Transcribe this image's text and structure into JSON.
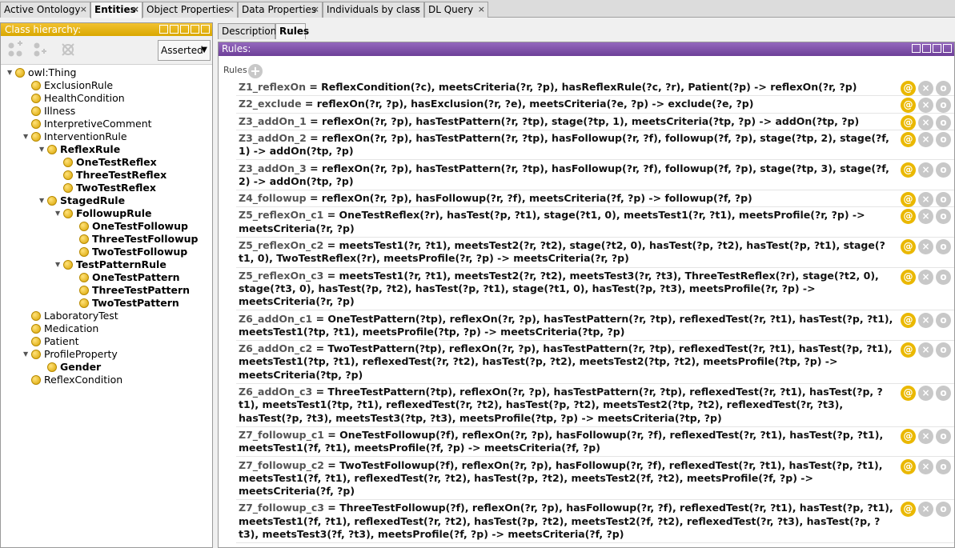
{
  "tabs": [
    {
      "label": "Active Ontology",
      "active": false
    },
    {
      "label": "Entities",
      "active": true
    },
    {
      "label": "Object Properties",
      "active": false
    },
    {
      "label": "Data Properties",
      "active": false
    },
    {
      "label": "Individuals by class",
      "active": false
    },
    {
      "label": "DL Query",
      "active": false
    }
  ],
  "tab_close_glyph": "×",
  "left": {
    "header": "Class hierarchy:",
    "mode": "Asserted",
    "tree": [
      {
        "label": "owl:Thing",
        "depth": 0,
        "bold": false,
        "expanded": true
      },
      {
        "label": "ExclusionRule",
        "depth": 1,
        "bold": false
      },
      {
        "label": "HealthCondition",
        "depth": 1,
        "bold": false
      },
      {
        "label": "Illness",
        "depth": 1,
        "bold": false
      },
      {
        "label": "InterpretiveComment",
        "depth": 1,
        "bold": false
      },
      {
        "label": "InterventionRule",
        "depth": 1,
        "bold": false,
        "expanded": true
      },
      {
        "label": "ReflexRule",
        "depth": 2,
        "bold": true,
        "expanded": true
      },
      {
        "label": "OneTestReflex",
        "depth": 3,
        "bold": true
      },
      {
        "label": "ThreeTestReflex",
        "depth": 3,
        "bold": true
      },
      {
        "label": "TwoTestReflex",
        "depth": 3,
        "bold": true
      },
      {
        "label": "StagedRule",
        "depth": 2,
        "bold": true,
        "expanded": true
      },
      {
        "label": "FollowupRule",
        "depth": 3,
        "bold": true,
        "expanded": true
      },
      {
        "label": "OneTestFollowup",
        "depth": 4,
        "bold": true
      },
      {
        "label": "ThreeTestFollowup",
        "depth": 4,
        "bold": true
      },
      {
        "label": "TwoTestFollowup",
        "depth": 4,
        "bold": true
      },
      {
        "label": "TestPatternRule",
        "depth": 3,
        "bold": true,
        "expanded": true
      },
      {
        "label": "OneTestPattern",
        "depth": 4,
        "bold": true
      },
      {
        "label": "ThreeTestPattern",
        "depth": 4,
        "bold": true
      },
      {
        "label": "TwoTestPattern",
        "depth": 4,
        "bold": true
      },
      {
        "label": "LaboratoryTest",
        "depth": 1,
        "bold": false
      },
      {
        "label": "Medication",
        "depth": 1,
        "bold": false
      },
      {
        "label": "Patient",
        "depth": 1,
        "bold": false
      },
      {
        "label": "ProfileProperty",
        "depth": 1,
        "bold": false,
        "expanded": true
      },
      {
        "label": "Gender",
        "depth": 2,
        "bold": true
      },
      {
        "label": "ReflexCondition",
        "depth": 1,
        "bold": false
      }
    ]
  },
  "right": {
    "tabs": [
      {
        "label": "Description",
        "active": false
      },
      {
        "label": "Rules",
        "active": true
      }
    ],
    "header": "Rules:",
    "rules_label": "Rules",
    "add_glyph": "+",
    "control_glyphs": {
      "annotate": "@",
      "delete": "×",
      "edit": "o"
    },
    "rules": [
      {
        "name": "Z1_reflexOn",
        "body": " = ReflexCondition(?c), meetsCriteria(?r, ?p), hasReflexRule(?c, ?r), Patient(?p) -> reflexOn(?r, ?p)",
        "lines": 1
      },
      {
        "name": "Z2_exclude",
        "body": " = reflexOn(?r, ?p), hasExclusion(?r, ?e), meetsCriteria(?e, ?p) -> exclude(?e, ?p)",
        "lines": 1
      },
      {
        "name": "Z3_addOn_1",
        "body": " = reflexOn(?r, ?p), hasTestPattern(?r, ?tp), stage(?tp, 1), meetsCriteria(?tp, ?p) -> addOn(?tp, ?p)",
        "lines": 1
      },
      {
        "name": "Z3_addOn_2",
        "body": " = reflexOn(?r, ?p), hasTestPattern(?r, ?tp), hasFollowup(?r, ?f), followup(?f, ?p), stage(?tp, 2), stage(?f, 1) -> addOn(?tp, ?p)",
        "lines": 2
      },
      {
        "name": "Z3_addOn_3",
        "body": " = reflexOn(?r, ?p), hasTestPattern(?r, ?tp), hasFollowup(?r, ?f), followup(?f, ?p), stage(?tp, 3), stage(?f, 2) -> addOn(?tp, ?p)",
        "lines": 2
      },
      {
        "name": "Z4_followup",
        "body": " = reflexOn(?r, ?p), hasFollowup(?r, ?f), meetsCriteria(?f, ?p) -> followup(?f, ?p)",
        "lines": 1
      },
      {
        "name": "Z5_reflexOn_c1",
        "body": " = OneTestReflex(?r), hasTest(?p, ?t1), stage(?t1, 0), meetsTest1(?r, ?t1), meetsProfile(?r, ?p) -> meetsCriteria(?r, ?p)",
        "lines": 2
      },
      {
        "name": "Z5_reflexOn_c2",
        "body": " = meetsTest1(?r, ?t1), meetsTest2(?r, ?t2), stage(?t2, 0), hasTest(?p, ?t2), hasTest(?p, ?t1), stage(?t1, 0), TwoTestReflex(?r), meetsProfile(?r, ?p) -> meetsCriteria(?r, ?p)",
        "lines": 2
      },
      {
        "name": "Z5_reflexOn_c3",
        "body": " = meetsTest1(?r, ?t1), meetsTest2(?r, ?t2), meetsTest3(?r, ?t3), ThreeTestReflex(?r), stage(?t2, 0), stage(?t3, 0), hasTest(?p, ?t2), hasTest(?p, ?t1), stage(?t1, 0), hasTest(?p, ?t3), meetsProfile(?r, ?p) -> meetsCriteria(?r, ?p)",
        "lines": 3
      },
      {
        "name": "Z6_addOn_c1",
        "body": " = OneTestPattern(?tp), reflexOn(?r, ?p), hasTestPattern(?r, ?tp), reflexedTest(?r, ?t1), hasTest(?p, ?t1), meetsTest1(?tp, ?t1), meetsProfile(?tp, ?p) -> meetsCriteria(?tp, ?p)",
        "lines": 2
      },
      {
        "name": "Z6_addOn_c2",
        "body": " = TwoTestPattern(?tp), reflexOn(?r, ?p), hasTestPattern(?r, ?tp), reflexedTest(?r, ?t1), hasTest(?p, ?t1), meetsTest1(?tp, ?t1), reflexedTest(?r, ?t2), hasTest(?p, ?t2), meetsTest2(?tp, ?t2), meetsProfile(?tp, ?p) -> meetsCriteria(?tp, ?p)",
        "lines": 3
      },
      {
        "name": "Z6_addOn_c3",
        "body": " = ThreeTestPattern(?tp), reflexOn(?r, ?p), hasTestPattern(?r, ?tp), reflexedTest(?r, ?t1), hasTest(?p, ?t1), meetsTest1(?tp, ?t1), reflexedTest(?r, ?t2), hasTest(?p, ?t2), meetsTest2(?tp, ?t2), reflexedTest(?r, ?t3), hasTest(?p, ?t3), meetsTest3(?tp, ?t3), meetsProfile(?tp, ?p) -> meetsCriteria(?tp, ?p)",
        "lines": 3
      },
      {
        "name": "Z7_followup_c1",
        "body": " = OneTestFollowup(?f), reflexOn(?r, ?p), hasFollowup(?r, ?f), reflexedTest(?r, ?t1), hasTest(?p, ?t1), meetsTest1(?f, ?t1), meetsProfile(?f, ?p) -> meetsCriteria(?f, ?p)",
        "lines": 2
      },
      {
        "name": "Z7_followup_c2",
        "body": " = TwoTestFollowup(?f), reflexOn(?r, ?p), hasFollowup(?r, ?f), reflexedTest(?r, ?t1), hasTest(?p, ?t1), meetsTest1(?f, ?t1), reflexedTest(?r, ?t2), hasTest(?p, ?t2), meetsTest2(?f, ?t2), meetsProfile(?f, ?p) -> meetsCriteria(?f, ?p)",
        "lines": 3
      },
      {
        "name": "Z7_followup_c3",
        "body": " = ThreeTestFollowup(?f), reflexOn(?r, ?p), hasFollowup(?r, ?f), reflexedTest(?r, ?t1), hasTest(?p, ?t1), meetsTest1(?f, ?t1), reflexedTest(?r, ?t2), hasTest(?p, ?t2), meetsTest2(?f, ?t2), reflexedTest(?r, ?t3), hasTest(?p, ?t3), meetsTest3(?f, ?t3), meetsProfile(?f, ?p) -> meetsCriteria(?f, ?p)",
        "lines": 3
      }
    ]
  },
  "colors": {
    "class_hierarchy_header": "#e0b000",
    "rules_header": "#7a4fa3",
    "annotate_button": "#eab800"
  }
}
